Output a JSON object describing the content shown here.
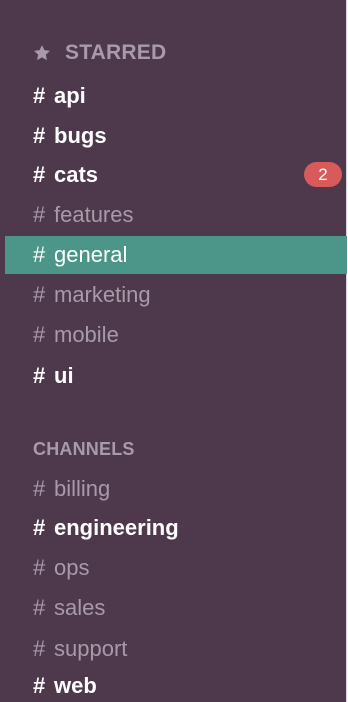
{
  "starred": {
    "title": "STARRED",
    "channels": [
      {
        "hash": "#",
        "name": "api",
        "style": "bold"
      },
      {
        "hash": "#",
        "name": "bugs",
        "style": "bold"
      },
      {
        "hash": "#",
        "name": "cats",
        "style": "bold",
        "badge": "2"
      },
      {
        "hash": "#",
        "name": "features",
        "style": "muted"
      },
      {
        "hash": "#",
        "name": "general",
        "style": "active"
      },
      {
        "hash": "#",
        "name": "marketing",
        "style": "muted"
      },
      {
        "hash": "#",
        "name": "mobile",
        "style": "muted"
      },
      {
        "hash": "#",
        "name": "ui",
        "style": "bold"
      }
    ]
  },
  "channels": {
    "title": "CHANNELS",
    "channels": [
      {
        "hash": "#",
        "name": "billing",
        "style": "muted"
      },
      {
        "hash": "#",
        "name": "engineering",
        "style": "bold"
      },
      {
        "hash": "#",
        "name": "ops",
        "style": "muted"
      },
      {
        "hash": "#",
        "name": "sales",
        "style": "muted"
      },
      {
        "hash": "#",
        "name": "support",
        "style": "muted"
      },
      {
        "hash": "#",
        "name": "web",
        "style": "bold"
      }
    ]
  },
  "colors": {
    "sidebar_bg": "#4d394b",
    "active_bg": "#4c9689",
    "muted_text": "#a89aa8",
    "bold_text": "#ffffff",
    "badge_bg": "#d95a5a"
  },
  "icons": {
    "starred_header": "star-icon",
    "channel_prefix": "hash"
  }
}
